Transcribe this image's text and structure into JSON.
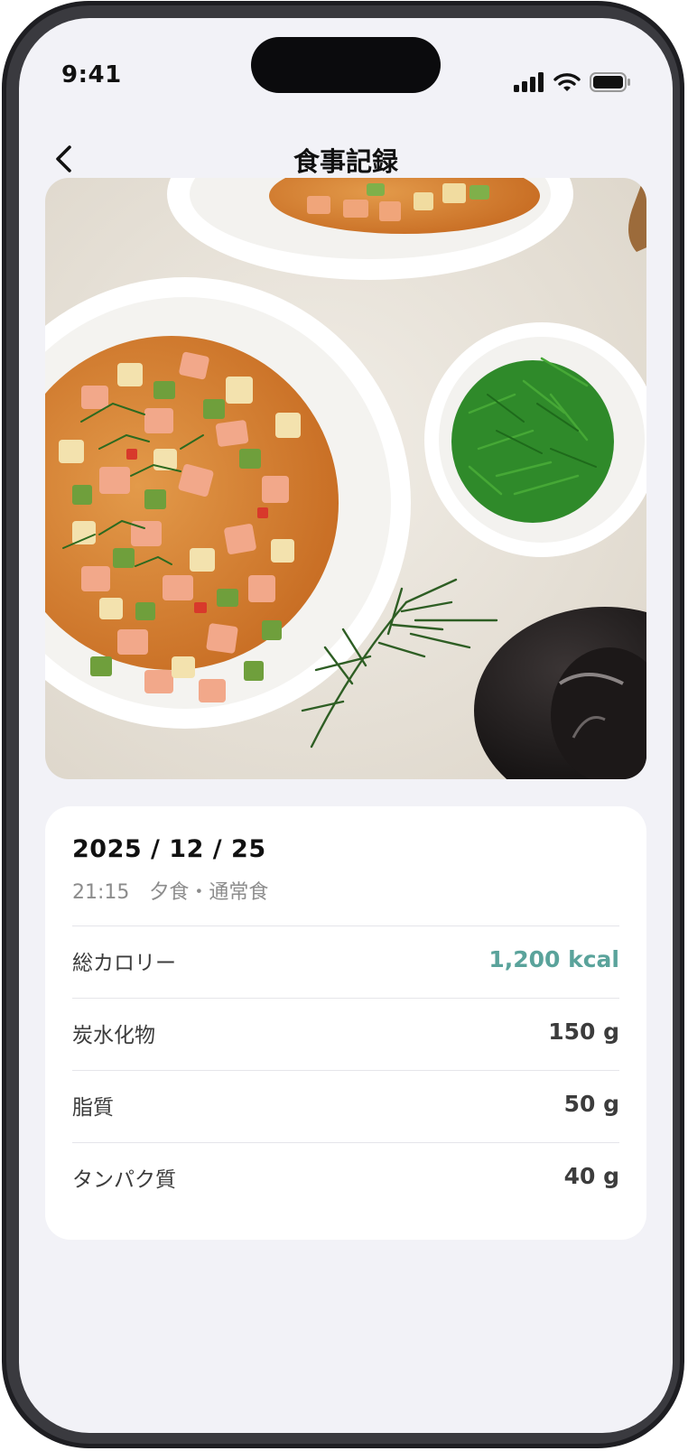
{
  "status_bar": {
    "time": "9:41",
    "signal_icon": "cellular-signal-icon",
    "wifi_icon": "wifi-icon",
    "battery_icon": "battery-icon"
  },
  "header": {
    "title": "食事記録",
    "back_icon": "chevron-left-icon"
  },
  "meal_photo": {
    "description_icon": "food-photo"
  },
  "record": {
    "date": "2025 / 12 / 25",
    "subline": "21:15　夕食・通常食",
    "rows": [
      {
        "label": "総カロリー",
        "value": "1,200 kcal"
      },
      {
        "label": "炭水化物",
        "value": "150 g"
      },
      {
        "label": "脂質",
        "value": "50 g"
      },
      {
        "label": "タンパク質",
        "value": "40 g"
      }
    ]
  },
  "colors": {
    "accent": "#5aa39b",
    "background": "#f2f2f7",
    "card": "#ffffff"
  }
}
